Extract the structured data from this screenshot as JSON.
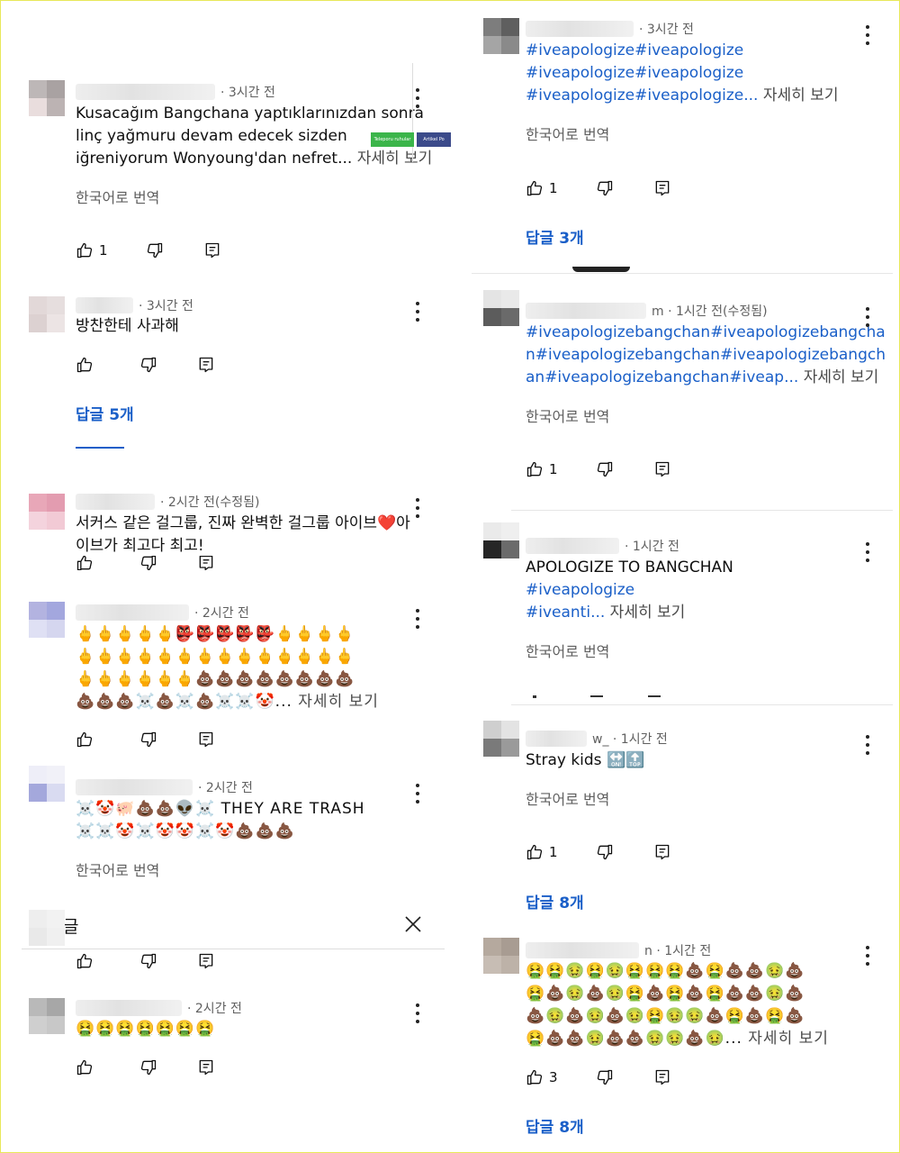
{
  "colors": {
    "link": "#1a5fc8",
    "meta": "#606060"
  },
  "icons": {
    "like": "thumbs-up-icon",
    "dislike": "thumbs-down-icon",
    "reply": "reply-icon",
    "menu": "more-vert-icon",
    "close": "close-icon"
  },
  "left": [
    {
      "time": "· 3시간 전",
      "lines": [
        "Kusacağım Bangchana yaptıklarınızdan sonra",
        "linç yağmuru devam edecek sizden",
        "iğreniyorum Wonyoung'dan nefret..."
      ],
      "more": " 자세히 보기",
      "translate": "한국어로 번역",
      "likes": "1",
      "badges": [
        "Teleporu ruhular",
        "Artikel Po"
      ]
    },
    {
      "time": "· 3시간 전",
      "lines": [
        "방찬한테 사과해"
      ],
      "likes": "",
      "replies": "답글 5개"
    },
    {
      "time": "· 2시간 전(수정됨)",
      "lines": [
        "서커스 같은 걸그룹, 진짜 완벽한 걸그룹 아이브❤️아",
        "이브가 최고다 최고!"
      ]
    },
    {
      "time": "· 2시간 전",
      "lines": [
        "🖕🖕🖕🖕🖕👺👺👺👺👺🖕🖕🖕🖕",
        "🖕🖕🖕🖕🖕🖕🖕🖕🖕🖕🖕🖕🖕🖕",
        "🖕🖕🖕🖕🖕🖕💩💩💩💩💩💩💩💩",
        "💩💩💩☠️💩☠️💩☠️☠️🤡..."
      ],
      "more": " 자세히 보기"
    },
    {
      "time": "· 2시간 전",
      "lines": [
        "☠️🤡🐖💩💩👽☠️ THEY ARE  TRASH",
        "☠️☠️🤡☠️🤡🤡☠️🤡💩💩💩"
      ],
      "translate": "한국어로 번역"
    },
    {
      "time": "· 2시간 전",
      "lines": [
        "🤮🤮🤮🤮🤮🤮🤮"
      ]
    }
  ],
  "sheet_title": "글",
  "right": [
    {
      "time": "· 3시간 전",
      "lines": [
        "#iveapologize#iveapologize",
        "#iveapologize#iveapologize",
        "#iveapologize#iveapologize..."
      ],
      "more": " 자세히 보기",
      "translate": "한국어로 번역",
      "likes": "1",
      "replies": "답글 3개"
    },
    {
      "time": "m · 1시간 전(수정됨)",
      "lines": [
        "#iveapologizebangchan#iveapologizebangcha",
        "n#iveapologizebangchan#iveapologizebangch",
        "an#iveapologizebangchan#iveap..."
      ],
      "more": " 자세히 보기",
      "translate": "한국어로 번역",
      "likes": "1"
    },
    {
      "time": "· 1시간 전",
      "lines": [
        "APOLOGIZE TO BANGCHAN",
        "#iveapologize",
        "#iveanti..."
      ],
      "more": " 자세히 보기",
      "translate": "한국어로 번역"
    },
    {
      "time": "w_ · 1시간 전",
      "lines": [
        "Stray kids 🔛🔝"
      ],
      "translate": "한국어로 번역",
      "likes": "1",
      "replies": "답글 8개"
    },
    {
      "time": "n · 1시간 전",
      "lines": [
        "🤮🤮🤢🤮🤢🤮🤮🤮💩🤮💩💩🤢💩",
        "🤮💩🤢💩🤢🤮💩🤮💩🤮💩💩🤢💩",
        "💩🤢💩🤢💩🤢🤮🤢🤢💩🤮💩🤮💩",
        "🤮💩💩🤢💩💩🤢🤢💩🤢..."
      ],
      "more": " 자세히 보기",
      "likes": "3",
      "replies": "답글 8개"
    }
  ]
}
